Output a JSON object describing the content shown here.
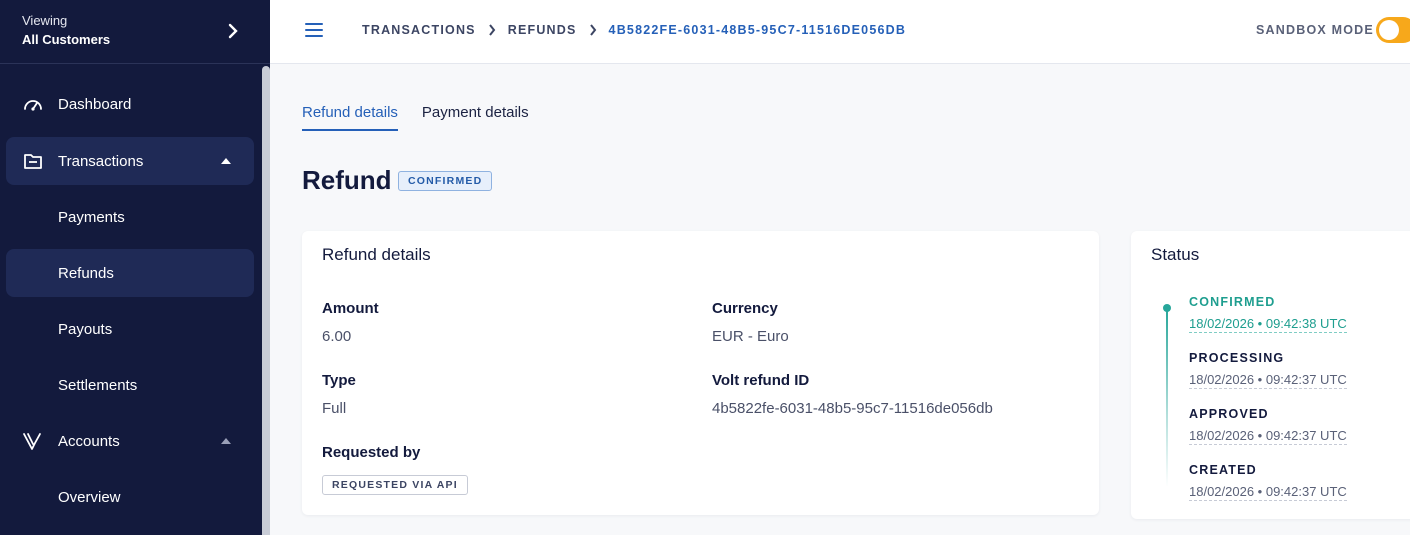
{
  "sidebar": {
    "viewing_label": "Viewing",
    "viewing_value": "All Customers",
    "items": [
      {
        "label": "Dashboard"
      },
      {
        "label": "Transactions"
      },
      {
        "label": "Payments"
      },
      {
        "label": "Refunds"
      },
      {
        "label": "Payouts"
      },
      {
        "label": "Settlements"
      },
      {
        "label": "Accounts"
      },
      {
        "label": "Overview"
      }
    ]
  },
  "header": {
    "breadcrumb": [
      "TRANSACTIONS",
      "REFUNDS",
      "4B5822FE-6031-48B5-95C7-11516DE056DB"
    ],
    "sandbox_label": "SANDBOX MODE"
  },
  "tabs": [
    {
      "label": "Refund details",
      "active": true
    },
    {
      "label": "Payment details",
      "active": false
    }
  ],
  "page": {
    "title": "Refund",
    "status_badge": "CONFIRMED"
  },
  "details": {
    "title": "Refund details",
    "amount_label": "Amount",
    "amount_value": "6.00",
    "currency_label": "Currency",
    "currency_value": "EUR - Euro",
    "type_label": "Type",
    "type_value": "Full",
    "refund_id_label": "Volt refund ID",
    "refund_id_value": "4b5822fe-6031-48b5-95c7-11516de056db",
    "requested_by_label": "Requested by",
    "requested_by_value": "REQUESTED VIA API"
  },
  "status": {
    "title": "Status",
    "steps": [
      {
        "state": "CONFIRMED",
        "timestamp": "18/02/2026  •  09:42:38 UTC"
      },
      {
        "state": "PROCESSING",
        "timestamp": "18/02/2026  •  09:42:37 UTC"
      },
      {
        "state": "APPROVED",
        "timestamp": "18/02/2026  •  09:42:37 UTC"
      },
      {
        "state": "CREATED",
        "timestamp": "18/02/2026  •  09:42:37 UTC"
      }
    ]
  },
  "colors": {
    "sidebar_bg": "#131a3d",
    "accent_blue": "#2560b8",
    "toggle_orange": "#f7a81b",
    "timeline_teal": "#26a69a"
  }
}
